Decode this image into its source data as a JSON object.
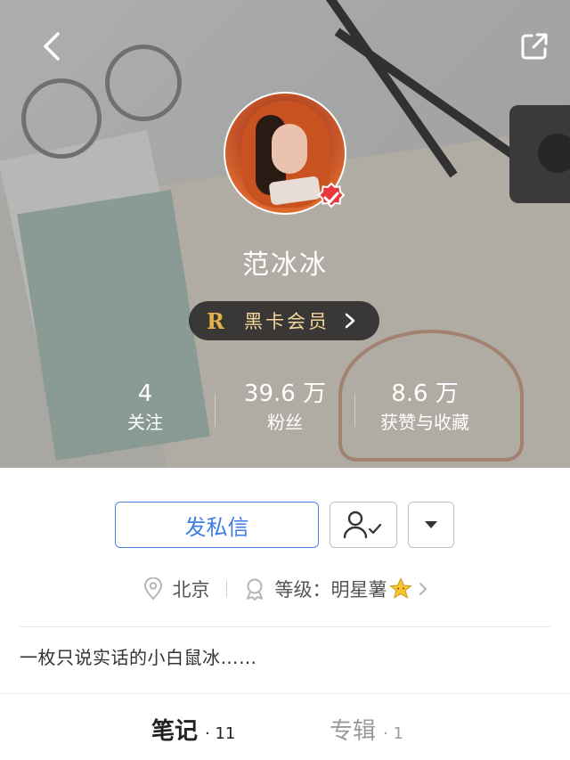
{
  "profile": {
    "nickname": "范冰冰",
    "vip": {
      "badge": "R",
      "label": "黑卡会员"
    }
  },
  "stats": [
    {
      "value": "4",
      "label": "关注"
    },
    {
      "value": "39.6 万",
      "label": "粉丝"
    },
    {
      "value": "8.6 万",
      "label": "获赞与收藏"
    }
  ],
  "actions": {
    "message_label": "发私信"
  },
  "meta": {
    "location": "北京",
    "level_prefix": "等级：",
    "level_name": "明星薯"
  },
  "bio": "一枚只说实话的小白鼠冰……",
  "tabs": [
    {
      "title": "笔记",
      "count": "· 11"
    },
    {
      "title": "专辑",
      "count": "· 1"
    }
  ],
  "colors": {
    "accent_blue": "#3f7de4",
    "verified_red": "#e8383d",
    "vip_gold": "#e0b24a"
  }
}
